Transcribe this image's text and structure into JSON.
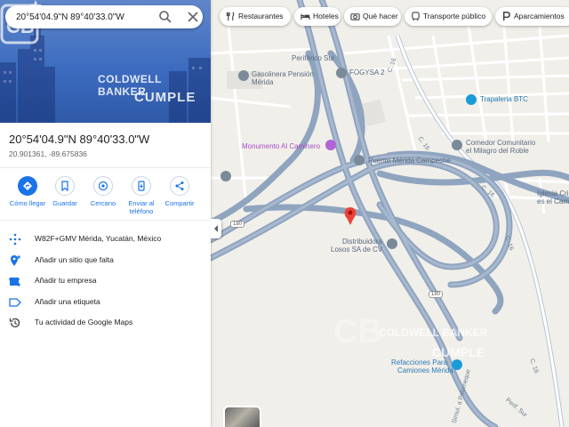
{
  "search": {
    "value": "20°54'04.9\"N 89°40'33.0\"W"
  },
  "hero": {
    "brand_line1": "COLDWELL BANKER",
    "brand_line2": "CUMPLE"
  },
  "place": {
    "title": "20°54'04.9\"N 89°40'33.0\"W",
    "coords": "20.901361, -89.675836"
  },
  "actions": [
    {
      "label": "Cómo llegar",
      "icon": "directions-icon"
    },
    {
      "label": "Guardar",
      "icon": "bookmark-icon"
    },
    {
      "label": "Cercano",
      "icon": "nearby-icon"
    },
    {
      "label": "Enviar al teléfono",
      "icon": "phone-icon"
    },
    {
      "label": "Compartir",
      "icon": "share-icon"
    }
  ],
  "info": [
    {
      "text": "W82F+GMV Mérida, Yucatán, México",
      "icon": "plus-code-icon"
    },
    {
      "text": "Añadir un sitio que falta",
      "icon": "add-place-icon"
    },
    {
      "text": "Añadir tu empresa",
      "icon": "business-icon"
    },
    {
      "text": "Añadir una etiqueta",
      "icon": "label-icon"
    },
    {
      "text": "Tu actividad de Google Maps",
      "icon": "history-icon"
    }
  ],
  "chips": [
    {
      "label": "Restaurantes",
      "icon": "restaurant-icon"
    },
    {
      "label": "Hoteles",
      "icon": "hotel-icon"
    },
    {
      "label": "Qué hacer",
      "icon": "camera-icon"
    },
    {
      "label": "Transporte público",
      "icon": "transit-icon"
    },
    {
      "label": "Aparcamientos",
      "icon": "parking-icon"
    }
  ],
  "map_labels": {
    "periferico_sur": "Periférico Sur",
    "gasolinera": "Gasolinera Pensión Mérida",
    "fogysa": "FOGYSA 2",
    "monumento": "Monumento Al Caminero",
    "puente": "Puente Mérida Campeche",
    "trapaleria": "Trapaleria BTC",
    "comedor1": "Comedor Comunitario",
    "comedor2": "el Milagro del Roble",
    "iglesia1": "Iglesia Cris",
    "iglesia2": "es el Camin",
    "distribuidora1": "Distribuidora",
    "distribuidora2": "Losos SA de CV",
    "refacciones1": "Refacciones Para",
    "refacciones2": "Camiones Mérida",
    "c16_a": "C. 16",
    "c16_b": "C. 16",
    "c16_c": "C. 16",
    "c16_d": "C. 16",
    "c16_e": "C. 16",
    "palomeque": "Simul. a Palomeque",
    "perif_sur2": "Perif. Sur",
    "shield_180a": "180",
    "shield_180b": "180",
    "watermark1": "COLDWELL BANKER",
    "watermark2": "CUMPLE"
  },
  "colors": {
    "accent": "#1a73e8",
    "road": "#8fa4bf",
    "pin": "#ea4335",
    "poi_purple": "#b164d8",
    "poi_gray": "#7a8a99",
    "poi_blue": "#1a9cd8"
  }
}
